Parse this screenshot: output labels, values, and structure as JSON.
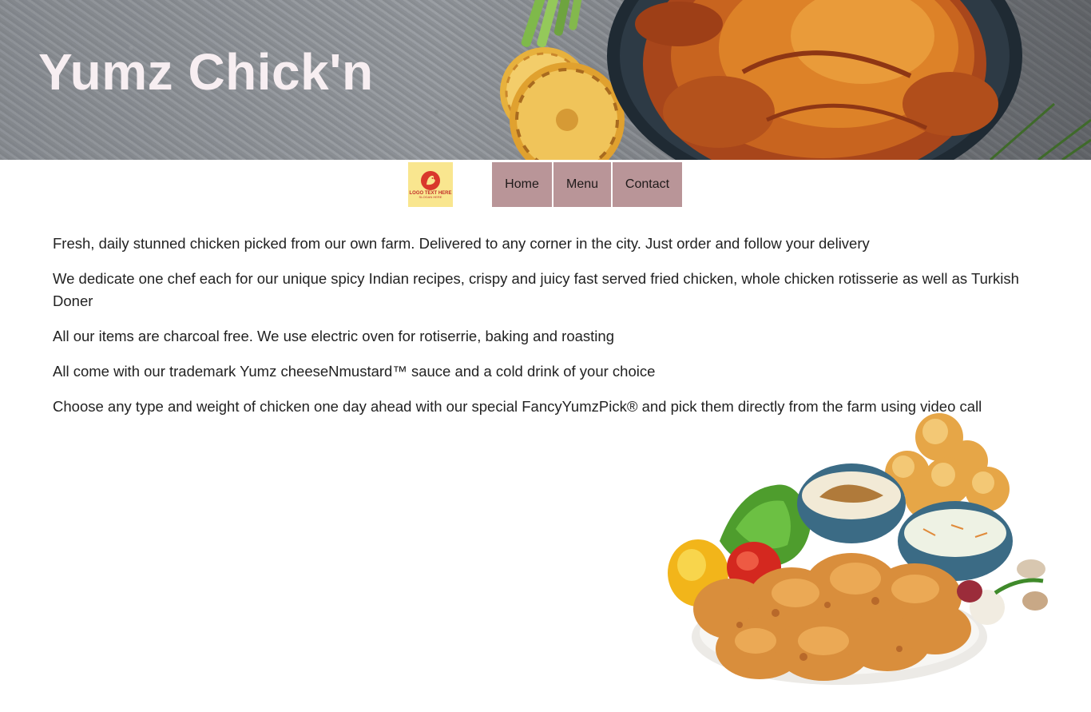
{
  "banner": {
    "title": "Yumz Chick'n",
    "image": "roast-chicken-on-stone-banner"
  },
  "nav": {
    "logo": {
      "text": "LOGO TEXT HERE",
      "sub": "SLOGAN HERE",
      "icon": "chicken-logo-icon"
    },
    "items": [
      {
        "label": "Home"
      },
      {
        "label": "Menu"
      },
      {
        "label": "Contact"
      }
    ]
  },
  "content": {
    "paragraphs": [
      "Fresh, daily stunned chicken picked from our own farm. Delivered to any corner in the city. Just order and follow your delivery",
      "We dedicate one chef each for our unique spicy Indian recipes, crispy and juicy fast served fried chicken, whole chicken rotisserie as well as Turkish Doner",
      "All our items are charcoal free. We use electric oven for rotiserrie, baking and roasting",
      "All come with our trademark Yumz cheeseNmustard™ sauce and a cold drink of your choice",
      "Choose any type and weight of chicken one day ahead with our special FancyYumzPick® and pick them directly from the farm using video call"
    ]
  },
  "images": {
    "food": "fried-chicken-platter-with-sides"
  },
  "colors": {
    "nav_button": "#b99598",
    "logo_bg": "#f9e68f",
    "title": "#f7eef1"
  }
}
